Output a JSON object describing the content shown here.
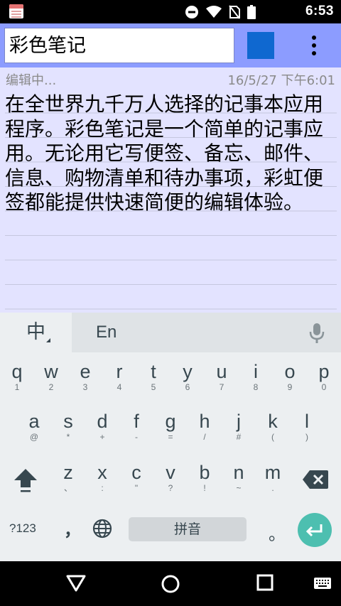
{
  "status_bar": {
    "time": "6:53",
    "icons": [
      "notes-app-icon",
      "do-not-disturb-icon",
      "wifi-icon",
      "no-sim-icon",
      "battery-icon"
    ]
  },
  "app_bar": {
    "title_value": "彩色笔记",
    "note_color": "#0f68d0",
    "background_color": "#8c9cff"
  },
  "note": {
    "status": "编辑中...",
    "date": "16/5/27 下午6:01",
    "body": "在全世界九千万人选择的记事本应用程序。彩色笔记是一个简单的记事应用。无论用它写便签、备忘、邮件、信息、购物清单和待办事项，彩虹便签都能提供快速简便的编辑体验。",
    "background_color": "#e3e3ff"
  },
  "keyboard": {
    "mode_chinese": "中",
    "mode_english": "En",
    "row1": [
      {
        "key": "q",
        "sub": "1"
      },
      {
        "key": "w",
        "sub": "2"
      },
      {
        "key": "e",
        "sub": "3"
      },
      {
        "key": "r",
        "sub": "4"
      },
      {
        "key": "t",
        "sub": "5"
      },
      {
        "key": "y",
        "sub": "6"
      },
      {
        "key": "u",
        "sub": "7"
      },
      {
        "key": "i",
        "sub": "8"
      },
      {
        "key": "o",
        "sub": "9"
      },
      {
        "key": "p",
        "sub": "0"
      }
    ],
    "row2": [
      {
        "key": "a",
        "sub": "@"
      },
      {
        "key": "s",
        "sub": "*"
      },
      {
        "key": "d",
        "sub": "+"
      },
      {
        "key": "f",
        "sub": "-"
      },
      {
        "key": "g",
        "sub": "="
      },
      {
        "key": "h",
        "sub": "/"
      },
      {
        "key": "j",
        "sub": "#"
      },
      {
        "key": "k",
        "sub": "("
      },
      {
        "key": "l",
        "sub": ")"
      }
    ],
    "row3": [
      {
        "key": "z",
        "sub": "、"
      },
      {
        "key": "x",
        "sub": ":"
      },
      {
        "key": "c",
        "sub": "\""
      },
      {
        "key": "v",
        "sub": "?"
      },
      {
        "key": "b",
        "sub": "!"
      },
      {
        "key": "n",
        "sub": "~"
      },
      {
        "key": "m",
        "sub": "."
      }
    ],
    "symbols_label": "?123",
    "comma_label": "，",
    "space_label": "拼音",
    "period_label": "。",
    "enter_color": "#4dbfb0"
  },
  "nav_bar": {
    "buttons": [
      "back-icon",
      "home-icon",
      "recents-icon",
      "keyboard-switch-icon"
    ]
  }
}
